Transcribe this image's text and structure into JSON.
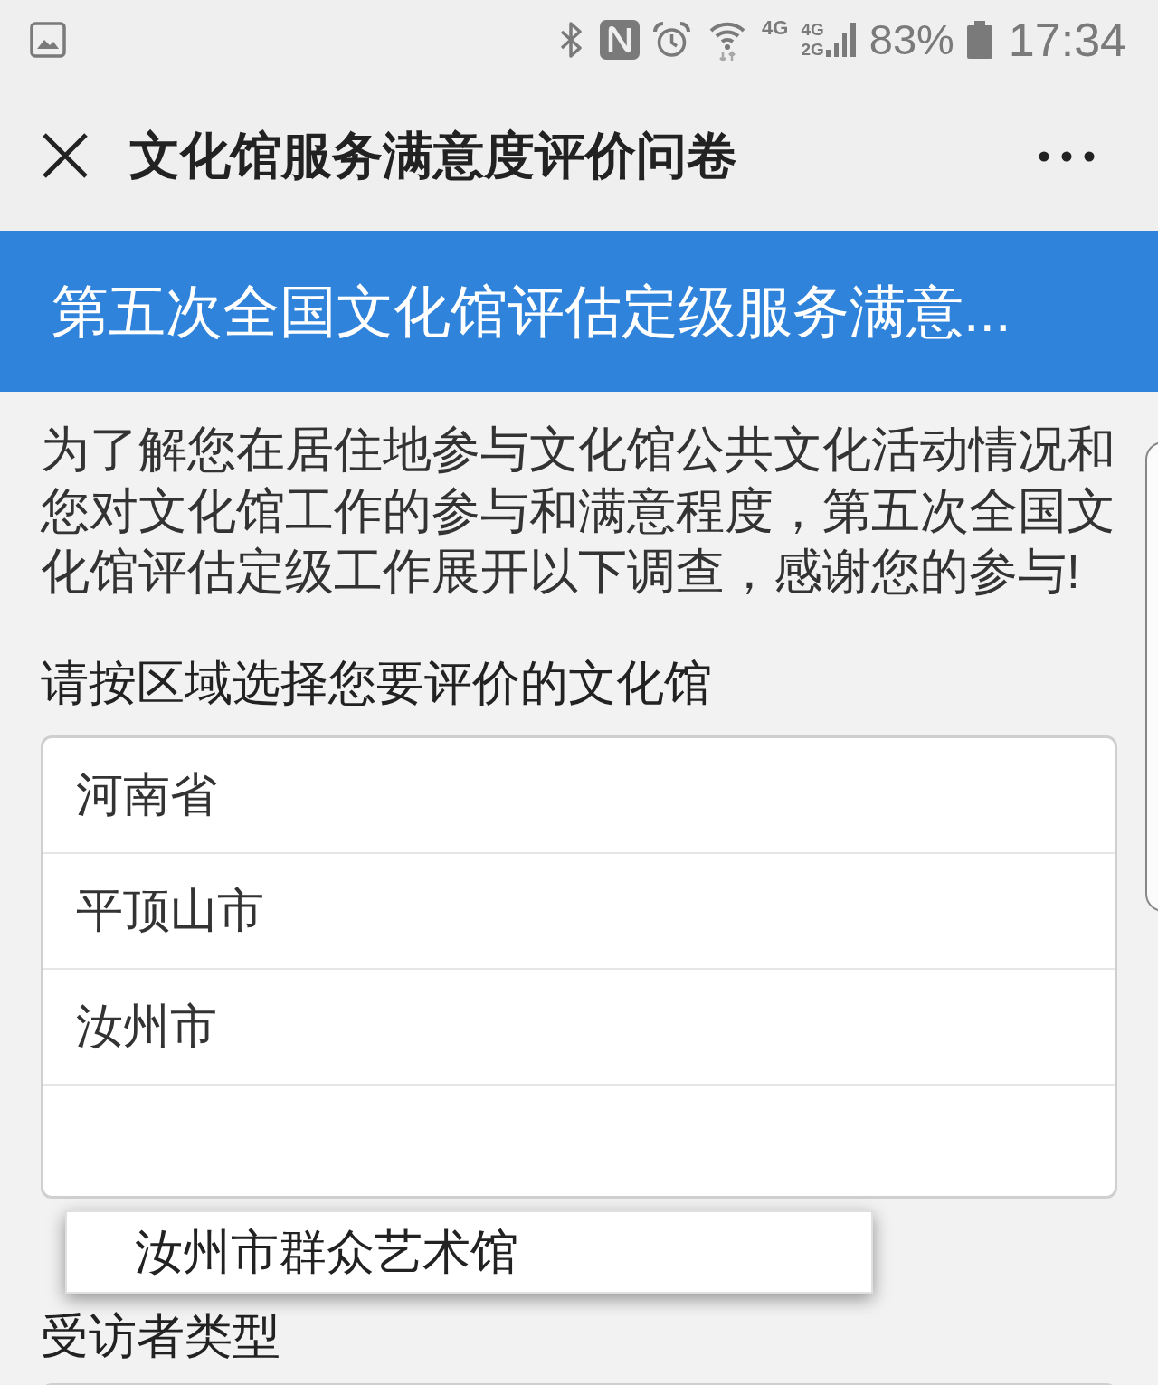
{
  "status_bar": {
    "sim_1_network": "4G",
    "sim_2_network": [
      "4G",
      "2G"
    ],
    "battery": "83%",
    "time": "17:34"
  },
  "title_bar": {
    "title": "文化馆服务满意度评价问卷"
  },
  "banner": {
    "title": "第五次全国文化馆评估定级服务满意..."
  },
  "intro": "为了解您在居住地参与文化馆公共文化活动情况和您对文化馆工作的参与和满意程度，第五次全国文化馆评估定级工作展开以下调查，感谢您的参与!",
  "questions": [
    {
      "label": "请按区域选择您要评价的文化馆",
      "kind": "list",
      "options": [
        "河南省",
        "平顶山市",
        "汝州市"
      ]
    },
    {
      "label": "受访者类型",
      "kind": "select"
    }
  ],
  "dropdown": {
    "options": [
      "汝州市群众艺术馆"
    ]
  }
}
